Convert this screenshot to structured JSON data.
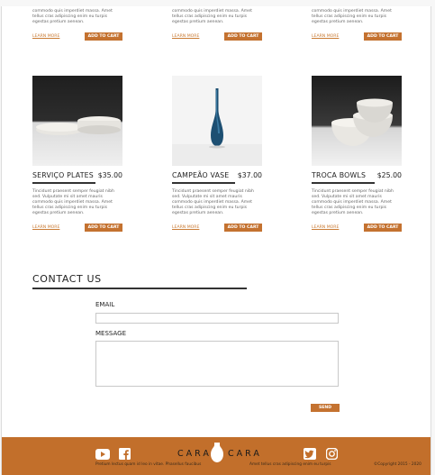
{
  "top_row": {
    "desc_lines": [
      "commodo quis imperdiet massa. Amet",
      "tellus cras adipiscing enim eu turpis",
      "egestas pretium aenean."
    ],
    "learn_more": "LEARN MORE",
    "add_to_cart": "ADD TO CART"
  },
  "products": [
    {
      "title": "SERVIÇO PLATES",
      "price": "$35.00",
      "image_icon": "plates-photo",
      "desc_lines": [
        "Tincidunt praesent semper feugiat nibh",
        "sed. Vulputate mi sit amet mauris",
        "commodo quis imperdiet massa. Amet",
        "tellus cras adipiscing enim eu turpis",
        "egestas pretium aenean."
      ],
      "learn_more": "LEARN MORE",
      "add_to_cart": "ADD TO CART"
    },
    {
      "title": "CAMPEÃO VASE",
      "price": "$37.00",
      "image_icon": "vase-photo",
      "desc_lines": [
        "Tincidunt praesent semper feugiat nibh",
        "sed. Vulputate mi sit amet mauris",
        "commodo quis imperdiet massa. Amet",
        "tellus cras adipiscing enim eu turpis",
        "egestas pretium aenean."
      ],
      "learn_more": "LEARN MORE",
      "add_to_cart": "ADD TO CART"
    },
    {
      "title": "TROCA BOWLS",
      "price": "$25.00",
      "image_icon": "bowls-photo",
      "desc_lines": [
        "Tincidunt praesent semper feugiat nibh",
        "sed. Vulputate mi sit amet mauris",
        "commodo quis imperdiet massa. Amet",
        "tellus cras adipiscing enim eu turpis",
        "egestas pretium aenean."
      ],
      "learn_more": "LEARN MORE",
      "add_to_cart": "ADD TO CART"
    }
  ],
  "contact": {
    "title": "CONTACT US",
    "email_label": "EMAIL",
    "email_value": "",
    "message_label": "MESSAGE",
    "message_value": "",
    "send_label": "SEND"
  },
  "footer": {
    "brand_left": "CARA",
    "brand_right": "CARA",
    "left_text": "Pretium lectus quam id leo in vitae. Phasellus faucibus",
    "right_text": "Amet tellus cras adipiscing enim eu turpis",
    "copyright": "©Copyright 2015 - 2020",
    "icons": [
      "youtube-icon",
      "facebook-icon",
      "vase-logo-icon",
      "twitter-icon",
      "instagram-icon"
    ]
  },
  "colors": {
    "accent": "#c47230",
    "footer_bg": "#c26f2b",
    "link": "#c97b34"
  }
}
